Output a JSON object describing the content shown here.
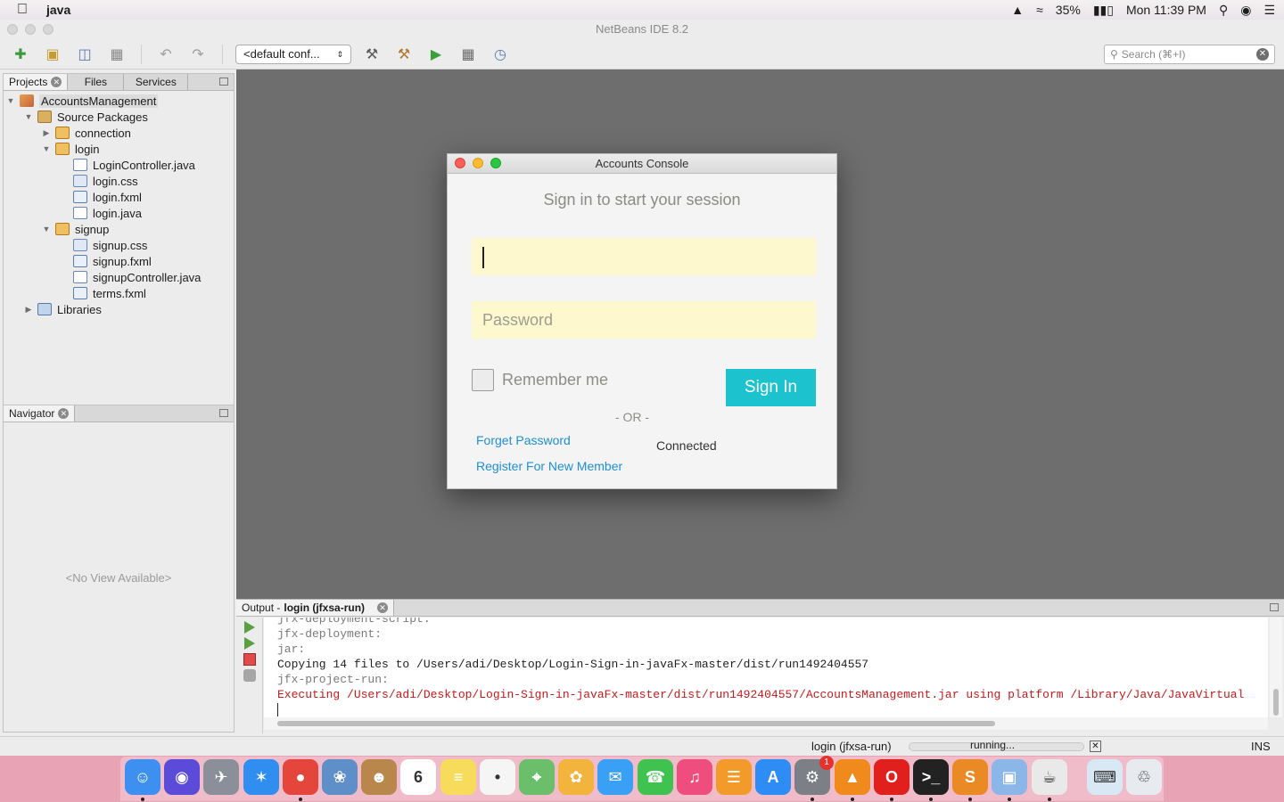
{
  "menubar": {
    "app_name": "java",
    "battery": "35%",
    "clock": "Mon 11:39 PM"
  },
  "window": {
    "title": "NetBeans IDE 8.2"
  },
  "toolbar": {
    "config_select": "<default conf...",
    "search_placeholder": "Search (⌘+I)"
  },
  "projects_panel": {
    "tabs": [
      "Projects",
      "Files",
      "Services"
    ],
    "tree": {
      "project": "AccountsManagement",
      "source_packages": "Source Packages",
      "packages": [
        {
          "name": "connection",
          "expanded": false,
          "files": []
        },
        {
          "name": "login",
          "expanded": true,
          "files": [
            "LoginController.java",
            "login.css",
            "login.fxml",
            "login.java"
          ]
        },
        {
          "name": "signup",
          "expanded": true,
          "files": [
            "signup.css",
            "signup.fxml",
            "signupController.java",
            "terms.fxml"
          ]
        }
      ],
      "libraries": "Libraries"
    }
  },
  "navigator_panel": {
    "tab": "Navigator",
    "empty_text": "<No View Available>"
  },
  "dialog": {
    "title": "Accounts Console",
    "heading": "Sign in to start your session",
    "username_value": "",
    "password_placeholder": "Password",
    "remember_label": "Remember me",
    "signin_label": "Sign In",
    "or_text": "- OR -",
    "forgot_link": "Forget Password",
    "register_link": "Register For New Member",
    "status": "Connected",
    "accent_color": "#1cc3cf",
    "field_color": "#fdf8cd"
  },
  "output_panel": {
    "tab_prefix": "Output - ",
    "tab_bold": "login (jfxsa-run)",
    "lines": [
      {
        "text": "jfx-deployment-script:",
        "style": "gray"
      },
      {
        "text": "jfx-deployment:",
        "style": "gray"
      },
      {
        "text": "jar:",
        "style": "gray"
      },
      {
        "text": "Copying 14 files to /Users/adi/Desktop/Login-Sign-in-javaFx-master/dist/run1492404557",
        "style": "black"
      },
      {
        "text": "jfx-project-run:",
        "style": "gray"
      },
      {
        "text": "Executing /Users/adi/Desktop/Login-Sign-in-javaFx-master/dist/run1492404557/AccountsManagement.jar using platform /Library/Java/JavaVirtual",
        "style": "red"
      }
    ]
  },
  "statusbar": {
    "task": "login (jfxsa-run)",
    "progress_label": "running...",
    "insert_mode": "INS"
  },
  "dock": {
    "apps": [
      {
        "name": "finder",
        "color": "#3d8ff0",
        "glyph": "☺"
      },
      {
        "name": "siri",
        "color": "#5b4bd8",
        "glyph": "◉"
      },
      {
        "name": "launchpad",
        "color": "#8a8f99",
        "glyph": "✈"
      },
      {
        "name": "safari",
        "color": "#2f8ef0",
        "glyph": "✶"
      },
      {
        "name": "chrome",
        "color": "#e4463b",
        "glyph": "●"
      },
      {
        "name": "preview",
        "color": "#5f8fc8",
        "glyph": "❀"
      },
      {
        "name": "contacts",
        "color": "#b9864c",
        "glyph": "☻"
      },
      {
        "name": "calendar",
        "color": "#ffffff",
        "glyph": "6"
      },
      {
        "name": "notes",
        "color": "#f6dc5a",
        "glyph": "≡"
      },
      {
        "name": "reminders",
        "color": "#f5f5f5",
        "glyph": "•"
      },
      {
        "name": "maps",
        "color": "#6bbf6a",
        "glyph": "⌖"
      },
      {
        "name": "photos",
        "color": "#f2b43c",
        "glyph": "✿"
      },
      {
        "name": "messages",
        "color": "#3aa0f5",
        "glyph": "✉"
      },
      {
        "name": "facetime",
        "color": "#3fc24f",
        "glyph": "☎"
      },
      {
        "name": "itunes",
        "color": "#ee4d7d",
        "glyph": "♫"
      },
      {
        "name": "ibooks",
        "color": "#f39b2a",
        "glyph": "☰"
      },
      {
        "name": "app-store",
        "color": "#2d8df5",
        "glyph": "A"
      },
      {
        "name": "system-preferences",
        "color": "#7d7f86",
        "glyph": "⚙",
        "badge": "1"
      },
      {
        "name": "vlc",
        "color": "#f08a1c",
        "glyph": "▲"
      },
      {
        "name": "opera",
        "color": "#e1201e",
        "glyph": "O"
      },
      {
        "name": "terminal",
        "color": "#222222",
        "glyph": ">_"
      },
      {
        "name": "sublime-text",
        "color": "#e98a24",
        "glyph": "S"
      },
      {
        "name": "virtualbox",
        "color": "#8bb6e8",
        "glyph": "▣"
      },
      {
        "name": "java",
        "color": "#e9e9e9",
        "glyph": "☕"
      },
      {
        "name": "keyboard-viewer",
        "color": "#d9e8f5",
        "glyph": "⌨"
      },
      {
        "name": "trash",
        "color": "#e7eaee",
        "glyph": "♲"
      }
    ]
  }
}
